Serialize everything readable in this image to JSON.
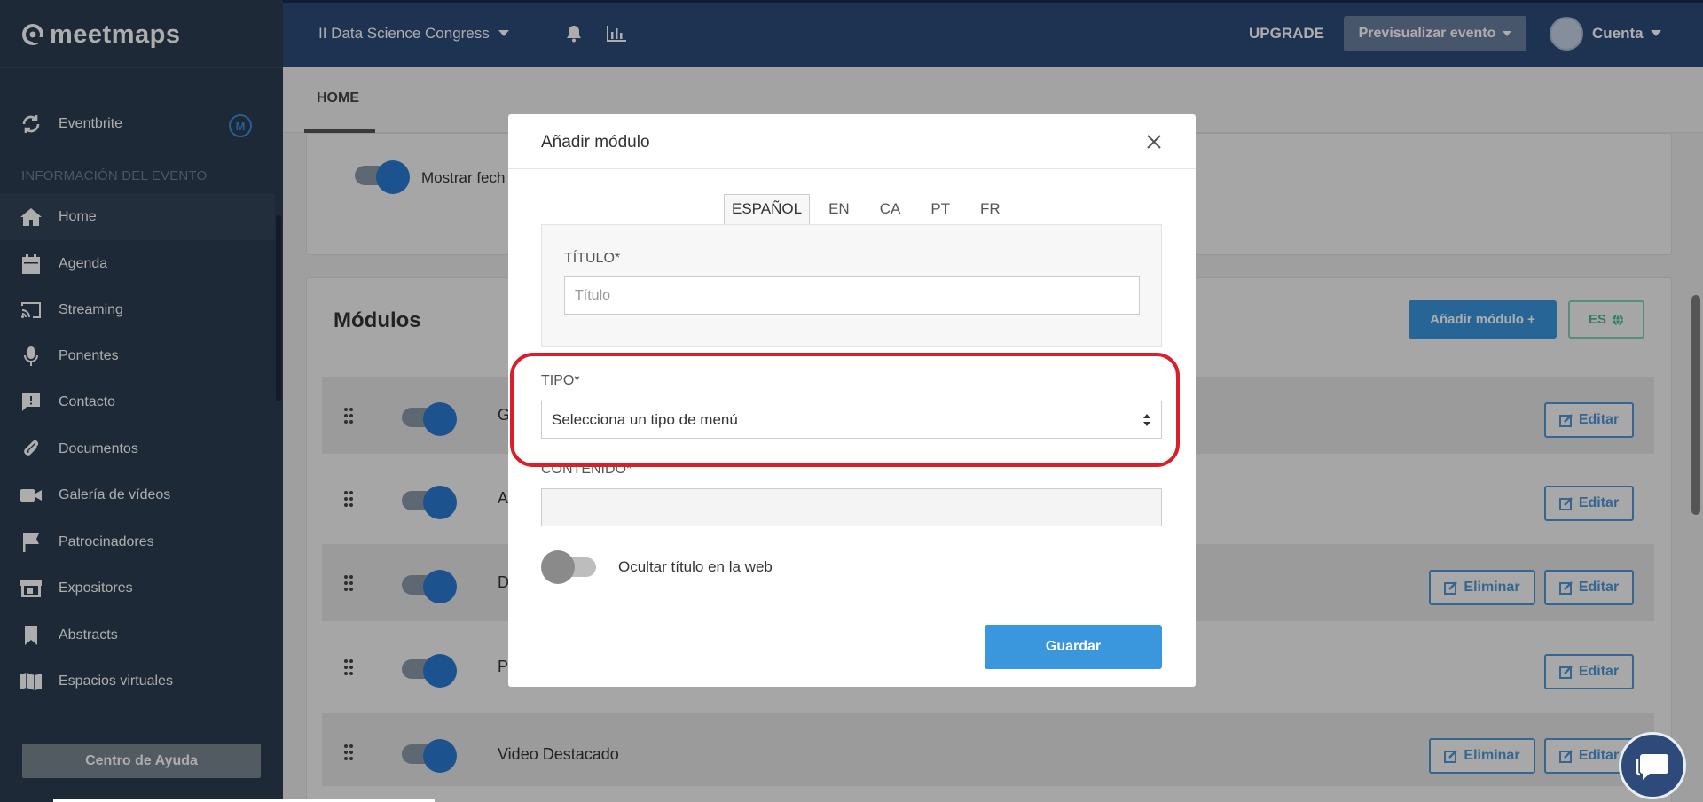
{
  "app": {
    "logo_text": "meetmaps"
  },
  "topbar": {
    "event_name": "II Data Science Congress",
    "upgrade_label": "UPGRADE",
    "preview_label": "Previsualizar evento",
    "account_label": "Cuenta"
  },
  "sidebar": {
    "integration": {
      "label": "Eventbrite",
      "badge": "M"
    },
    "section_title": "INFORMACIÓN DEL EVENTO",
    "items": [
      {
        "label": "Home",
        "icon": "home-icon"
      },
      {
        "label": "Agenda",
        "icon": "calendar-icon"
      },
      {
        "label": "Streaming",
        "icon": "cast-icon"
      },
      {
        "label": "Ponentes",
        "icon": "microphone-icon"
      },
      {
        "label": "Contacto",
        "icon": "chat-alert-icon"
      },
      {
        "label": "Documentos",
        "icon": "paperclip-icon"
      },
      {
        "label": "Galería de vídeos",
        "icon": "video-camera-icon"
      },
      {
        "label": "Patrocinadores",
        "icon": "flag-icon"
      },
      {
        "label": "Expositores",
        "icon": "store-icon"
      },
      {
        "label": "Abstracts",
        "icon": "bookmark-icon"
      },
      {
        "label": "Espacios virtuales",
        "icon": "map-icon"
      }
    ],
    "help_label": "Centro de Ayuda"
  },
  "content": {
    "tab_home": "HOME",
    "show_date_label": "Mostrar fech",
    "modules_title": "Módulos",
    "add_module_label": "Añadir módulo +",
    "lang_label": "ES",
    "rows": [
      {
        "name": "G",
        "buttons": [
          "Editar"
        ]
      },
      {
        "name": "A",
        "buttons": [
          "Editar"
        ]
      },
      {
        "name": "D",
        "buttons": [
          "Eliminar",
          "Editar"
        ]
      },
      {
        "name": "P",
        "buttons": [
          "Editar"
        ]
      },
      {
        "name": "Video Destacado",
        "buttons": [
          "Eliminar",
          "Editar"
        ]
      }
    ]
  },
  "modal": {
    "title": "Añadir módulo",
    "languages": [
      "ESPAÑOL",
      "EN",
      "CA",
      "PT",
      "FR"
    ],
    "active_language": "ESPAÑOL",
    "title_label": "TÍTULO*",
    "title_placeholder": "Título",
    "type_label": "TIPO*",
    "type_value": "Selecciona un tipo de menú",
    "content_label": "CONTENIDO*",
    "hide_title_label": "Ocultar título en la web",
    "hide_title_on": false,
    "save_label": "Guardar"
  },
  "colors": {
    "accent": "#3a96dd",
    "highlight": "#d91f2a",
    "sidebar": "#2b3d50",
    "topbar": "#2d4a7a"
  }
}
